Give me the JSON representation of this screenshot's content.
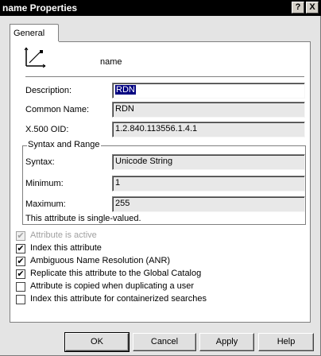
{
  "window": {
    "title": "name Properties",
    "help_glyph": "?",
    "close_glyph": "X"
  },
  "tabs": [
    {
      "label": "General"
    }
  ],
  "header": {
    "icon": "attribute-icon",
    "name": "name"
  },
  "fields": {
    "description_label": "Description:",
    "description_value": "RDN",
    "common_name_label": "Common Name:",
    "common_name_value": "RDN",
    "oid_label": "X.500 OID:",
    "oid_value": "1.2.840.113556.1.4.1"
  },
  "syntax_group": {
    "title": "Syntax and Range",
    "syntax_label": "Syntax:",
    "syntax_value": "Unicode String",
    "minimum_label": "Minimum:",
    "minimum_value": "1",
    "maximum_label": "Maximum:",
    "maximum_value": "255",
    "note": "This attribute is single-valued."
  },
  "options": [
    {
      "label": "Attribute is active",
      "checked": true,
      "disabled": true
    },
    {
      "label": "Index this attribute",
      "checked": true,
      "disabled": false
    },
    {
      "label": "Ambiguous Name Resolution (ANR)",
      "checked": true,
      "disabled": false
    },
    {
      "label": "Replicate this attribute to the Global Catalog",
      "checked": true,
      "disabled": false
    },
    {
      "label": "Attribute is copied when duplicating a user",
      "checked": false,
      "disabled": false
    },
    {
      "label": "Index this attribute for containerized searches",
      "checked": false,
      "disabled": false
    }
  ],
  "buttons": {
    "ok": "OK",
    "cancel": "Cancel",
    "apply": "Apply",
    "help": "Help"
  },
  "colors": {
    "titlebar": "#000000",
    "selection": "#000080"
  }
}
